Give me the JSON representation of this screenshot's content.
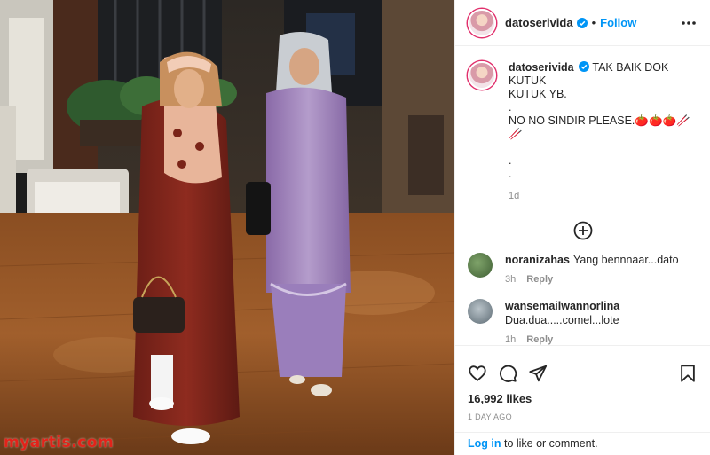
{
  "watermark": "myartis.com",
  "post": {
    "username": "datoserivida",
    "follow_label": "Follow",
    "caption_lines": [
      "TAK BAIK DOK KUTUK",
      "KUTUK YB.",
      ".",
      "NO NO SINDIR PLEASE.🍅🍅🍅🥢🥢",
      "",
      ".",
      "."
    ],
    "caption_time": "1d"
  },
  "comments": [
    {
      "username": "noranizahas",
      "text": "Yang bennnaar...dato",
      "time": "3h",
      "reply_label": "Reply"
    },
    {
      "username": "wansemailwannorlina",
      "text": "Dua.dua.....comel...lote",
      "time": "1h",
      "reply_label": "Reply"
    }
  ],
  "likes": "16,992 likes",
  "date": "1 DAY AGO",
  "login": {
    "link": "Log in",
    "rest": " to like or comment."
  },
  "icons": {
    "more": "more-options-icon",
    "verified": "verified-badge-icon",
    "load_more": "plus-circle-icon",
    "like": "heart-icon",
    "comment": "comment-icon",
    "share": "share-icon",
    "save": "bookmark-icon"
  },
  "colors": {
    "follow": "#0095f6",
    "watermark": "#e2231a",
    "muted": "#8e8e8e"
  }
}
